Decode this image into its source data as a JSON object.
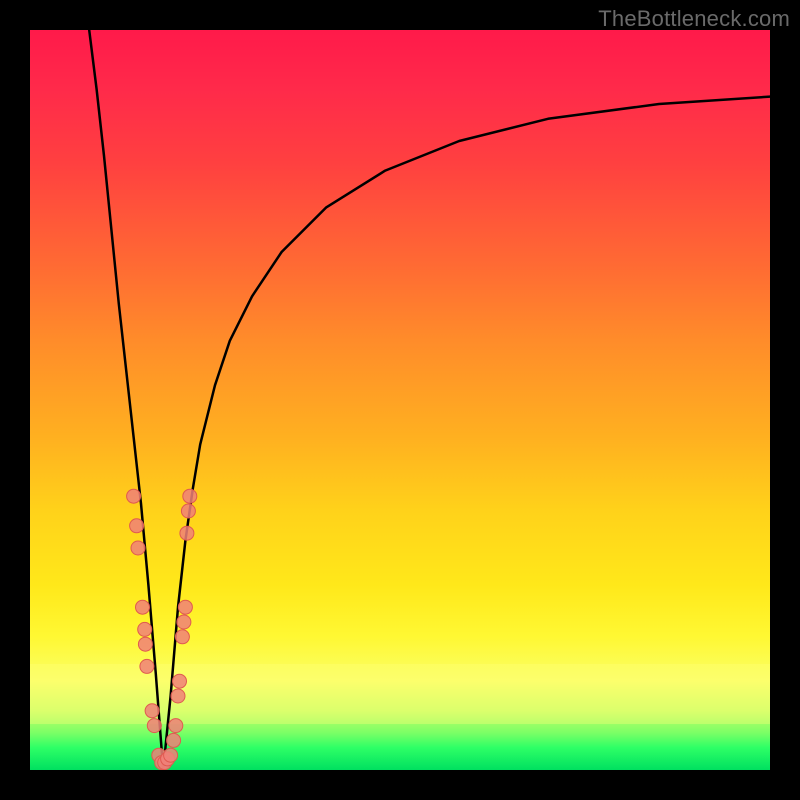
{
  "watermark": "TheBottleneck.com",
  "colors": {
    "curve": "#000000",
    "marker_fill": "#f08078",
    "marker_stroke": "#e05a50",
    "frame": "#000000"
  },
  "chart_data": {
    "type": "line",
    "title": "",
    "xlabel": "",
    "ylabel": "",
    "xlim": [
      0,
      100
    ],
    "ylim": [
      0,
      100
    ],
    "grid": false,
    "legend": false,
    "note": "x = component capability (arbitrary), y = bottleneck % (top=100 → red, bottom=0 → green). Curve is |log-ratio| shaped: steep descent to a minimum near x≈18, then rises and levels off at high x.",
    "curve_xy": [
      [
        8,
        100
      ],
      [
        9,
        92
      ],
      [
        10,
        83
      ],
      [
        11,
        73
      ],
      [
        12,
        63
      ],
      [
        13,
        54
      ],
      [
        14,
        45
      ],
      [
        15,
        36
      ],
      [
        16,
        25
      ],
      [
        17,
        13
      ],
      [
        18,
        0
      ],
      [
        19,
        10
      ],
      [
        20,
        22
      ],
      [
        21,
        31
      ],
      [
        22,
        38
      ],
      [
        23,
        44
      ],
      [
        25,
        52
      ],
      [
        27,
        58
      ],
      [
        30,
        64
      ],
      [
        34,
        70
      ],
      [
        40,
        76
      ],
      [
        48,
        81
      ],
      [
        58,
        85
      ],
      [
        70,
        88
      ],
      [
        85,
        90
      ],
      [
        100,
        91
      ]
    ],
    "markers_xy": [
      [
        14.0,
        37
      ],
      [
        14.4,
        33
      ],
      [
        14.6,
        30
      ],
      [
        15.2,
        22
      ],
      [
        15.5,
        19
      ],
      [
        15.6,
        17
      ],
      [
        15.8,
        14
      ],
      [
        16.5,
        8
      ],
      [
        16.8,
        6
      ],
      [
        17.4,
        2
      ],
      [
        17.8,
        1
      ],
      [
        18.2,
        1
      ],
      [
        18.6,
        1.5
      ],
      [
        19.0,
        2
      ],
      [
        19.4,
        4
      ],
      [
        19.7,
        6
      ],
      [
        20.0,
        10
      ],
      [
        20.2,
        12
      ],
      [
        20.6,
        18
      ],
      [
        20.8,
        20
      ],
      [
        21.0,
        22
      ],
      [
        21.2,
        32
      ],
      [
        21.4,
        35
      ],
      [
        21.6,
        37
      ]
    ]
  }
}
